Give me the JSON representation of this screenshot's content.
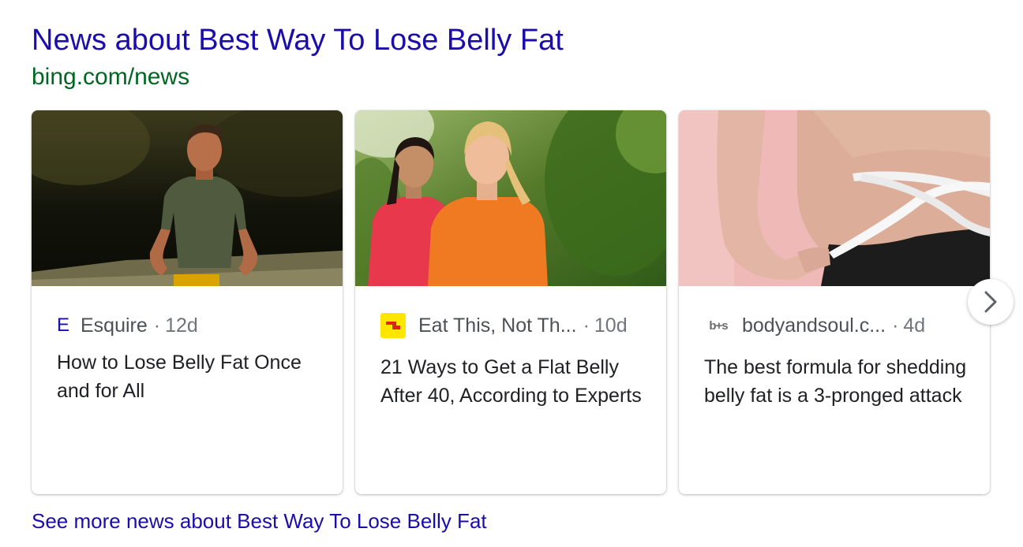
{
  "header": {
    "title": "News about Best Way To Lose Belly Fat",
    "source_url": "bing.com/news"
  },
  "cards": [
    {
      "source_logo": "E",
      "source": "Esquire",
      "separator": "·",
      "age": "12d",
      "headline": "How to Lose Belly Fat Once and for All",
      "image_icon": "man-running-photo"
    },
    {
      "source_logo": "eat-this-logo-icon",
      "source": "Eat This, Not Th...",
      "separator": "·",
      "age": "10d",
      "headline": "21 Ways to Get a Flat Belly After 40, According to Experts",
      "image_icon": "women-walking-photo"
    },
    {
      "source_logo": "b+s",
      "source": "bodyandsoul.c...",
      "separator": "·",
      "age": "4d",
      "headline": "The best formula for shedding belly fat is a 3-pronged attack",
      "image_icon": "measuring-tape-waist-photo"
    }
  ],
  "carousel": {
    "next_icon": "chevron-right-icon"
  },
  "footer": {
    "see_more": "See more news about Best Way To Lose Belly Fat"
  },
  "colors": {
    "link": "#1a0dab",
    "url_green": "#006621",
    "text": "#202124",
    "meta_text": "#4d5156",
    "meta_muted": "#70757a"
  }
}
